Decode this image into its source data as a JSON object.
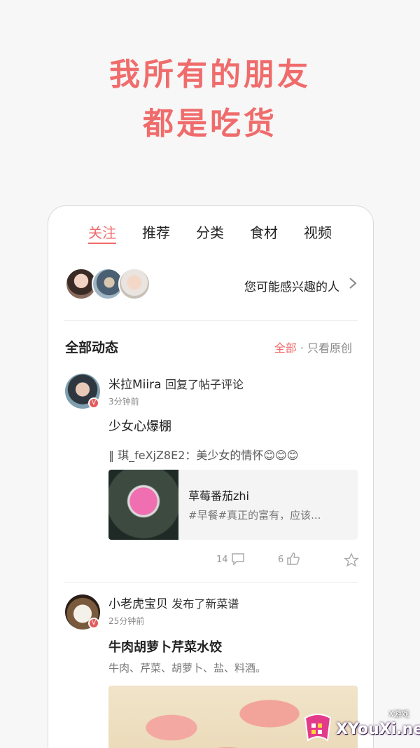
{
  "promo": {
    "line1": "我所有的朋友",
    "line2": "都是吃货"
  },
  "tabs": [
    {
      "label": "关注",
      "active": true
    },
    {
      "label": "推荐"
    },
    {
      "label": "分类"
    },
    {
      "label": "食材"
    },
    {
      "label": "视频"
    }
  ],
  "suggest": {
    "text": "您可能感兴趣的人"
  },
  "feed": {
    "title": "全部动态",
    "filter_all": "全部",
    "filter_sep": " · ",
    "filter_original": "只看原创"
  },
  "posts": [
    {
      "user": "米拉Miira",
      "action": "回复了帖子评论",
      "time": "3分钟前",
      "title": "少女心爆棚",
      "quote": "‖ 琪_feXjZ8E2：美少女的情怀😊😊😊",
      "card_title": "草莓番茄zhi",
      "card_desc": "#早餐#真正的富有，应该...",
      "comments": "14",
      "likes": "6",
      "badge": "V"
    },
    {
      "user": "小老虎宝贝",
      "action": "发布了新菜谱",
      "time": "25分钟前",
      "title": "牛肉胡萝卜芹菜水饺",
      "ingredients": "牛肉、芹菜、胡萝卜、盐、料酒。",
      "badge": "V"
    }
  ],
  "watermark": {
    "main": "XYouXi.net",
    "small": "X游戏"
  },
  "colors": {
    "accent": "#f06c6c",
    "background": "#f7f7f7"
  }
}
